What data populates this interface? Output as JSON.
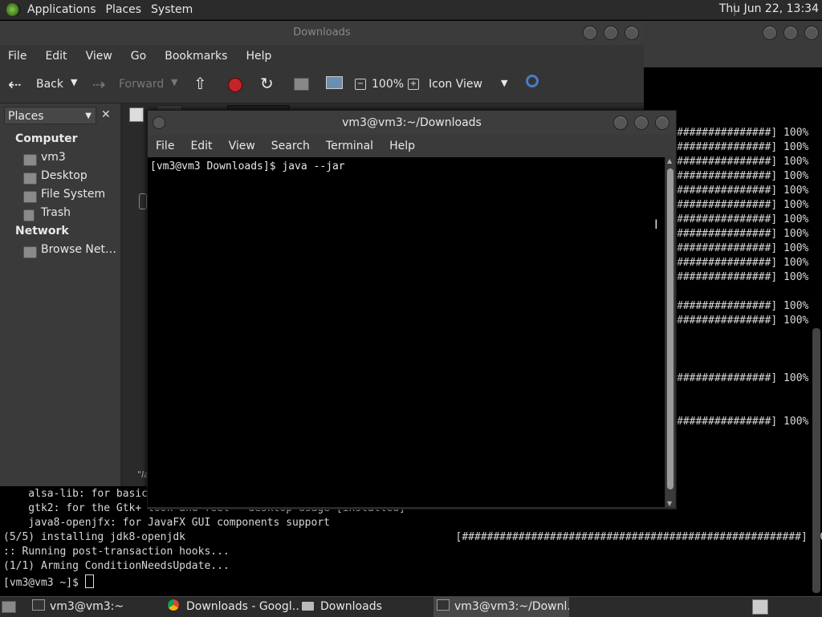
{
  "top_panel": {
    "menus": [
      "Applications",
      "Places",
      "System"
    ],
    "clock": "Thu Jun 22, 13:34"
  },
  "background_terminal": {
    "progress_bar": "###############]",
    "progress_pct": "100%",
    "progress_rows": 14,
    "bottom_lines": [
      "    alsa-lib: for basic",
      "    gtk2: for the Gtk+ look and feel - desktop usage [installed]",
      "    java8-openjfx: for JavaFX GUI components support",
      "(5/5) installing jdk8-openjdk                                           [######################################################] 100%",
      ":: Running post-transaction hooks...",
      "(1/1) Arming ConditionNeedsUpdate...",
      "[vm3@vm3 ~]$ "
    ]
  },
  "file_manager": {
    "title": "Downloads",
    "menus": [
      "File",
      "Edit",
      "View",
      "Go",
      "Bookmarks",
      "Help"
    ],
    "toolbar": {
      "back": "Back",
      "forward": "Forward",
      "zoom": "100%",
      "view_mode": "Icon View"
    },
    "sidebar": {
      "combo": "Places",
      "sections": [
        {
          "heading": "Computer",
          "items": [
            "vm3",
            "Desktop",
            "File System",
            "Trash"
          ]
        },
        {
          "heading": "Network",
          "items": [
            "Browse Net…"
          ]
        }
      ]
    },
    "status_fragment": "\"la"
  },
  "terminal": {
    "title": "vm3@vm3:~/Downloads",
    "menus": [
      "File",
      "Edit",
      "View",
      "Search",
      "Terminal",
      "Help"
    ],
    "prompt": "[vm3@vm3 Downloads]$ java --jar"
  },
  "taskbar": {
    "tasks": [
      {
        "label": "vm3@vm3:~",
        "icon": "terminal-icon"
      },
      {
        "label": "Downloads - Googl…",
        "icon": "chrome-icon"
      },
      {
        "label": "Downloads",
        "icon": "folder-icon"
      },
      {
        "label": "vm3@vm3:~/Downl…",
        "icon": "terminal-icon"
      }
    ]
  }
}
